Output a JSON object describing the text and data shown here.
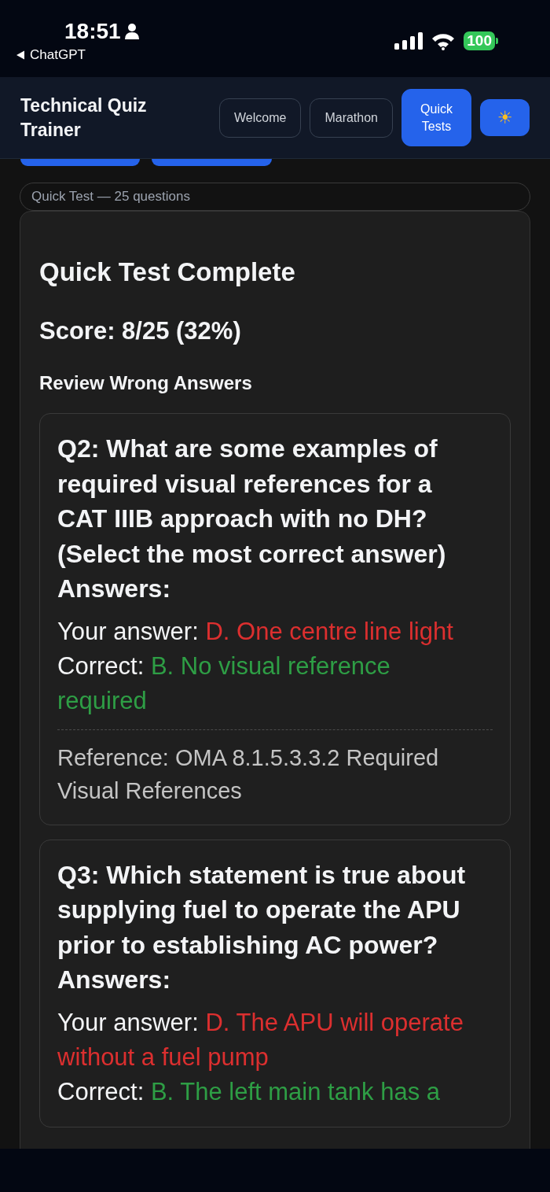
{
  "status_bar": {
    "time": "18:51",
    "back_label": "ChatGPT",
    "battery": "100"
  },
  "header": {
    "title": "Technical Quiz Trainer",
    "nav": [
      {
        "label": "Welcome",
        "selected": false
      },
      {
        "label": "Marathon",
        "selected": false
      },
      {
        "label": "Quick Tests",
        "selected": true
      }
    ],
    "theme_button": "☀"
  },
  "test_label": "Quick Test — 25 questions",
  "result": {
    "title": "Quick Test Complete",
    "score": "Score: 8/25 (32%)",
    "review_heading": "Review Wrong Answers",
    "questions": [
      {
        "question": "Q2: What are some examples of required visual references for a CAT IIIB approach with no DH? (Select the most correct answer) Answers:",
        "your_answer_label": "Your answer:",
        "your_answer": "D. One centre line light",
        "correct_label": "Correct:",
        "correct_answer": "B. No visual reference required",
        "reference": "Reference: OMA 8.1.5.3.3.2 Required Visual References"
      },
      {
        "question": "Q3: Which statement is true about supplying fuel to operate the APU prior to establishing AC power? Answers:",
        "your_answer_label": "Your answer:",
        "your_answer": "D. The APU will operate without a fuel pump",
        "correct_label": "Correct:",
        "correct_answer": "B. The left main tank has a"
      }
    ]
  }
}
